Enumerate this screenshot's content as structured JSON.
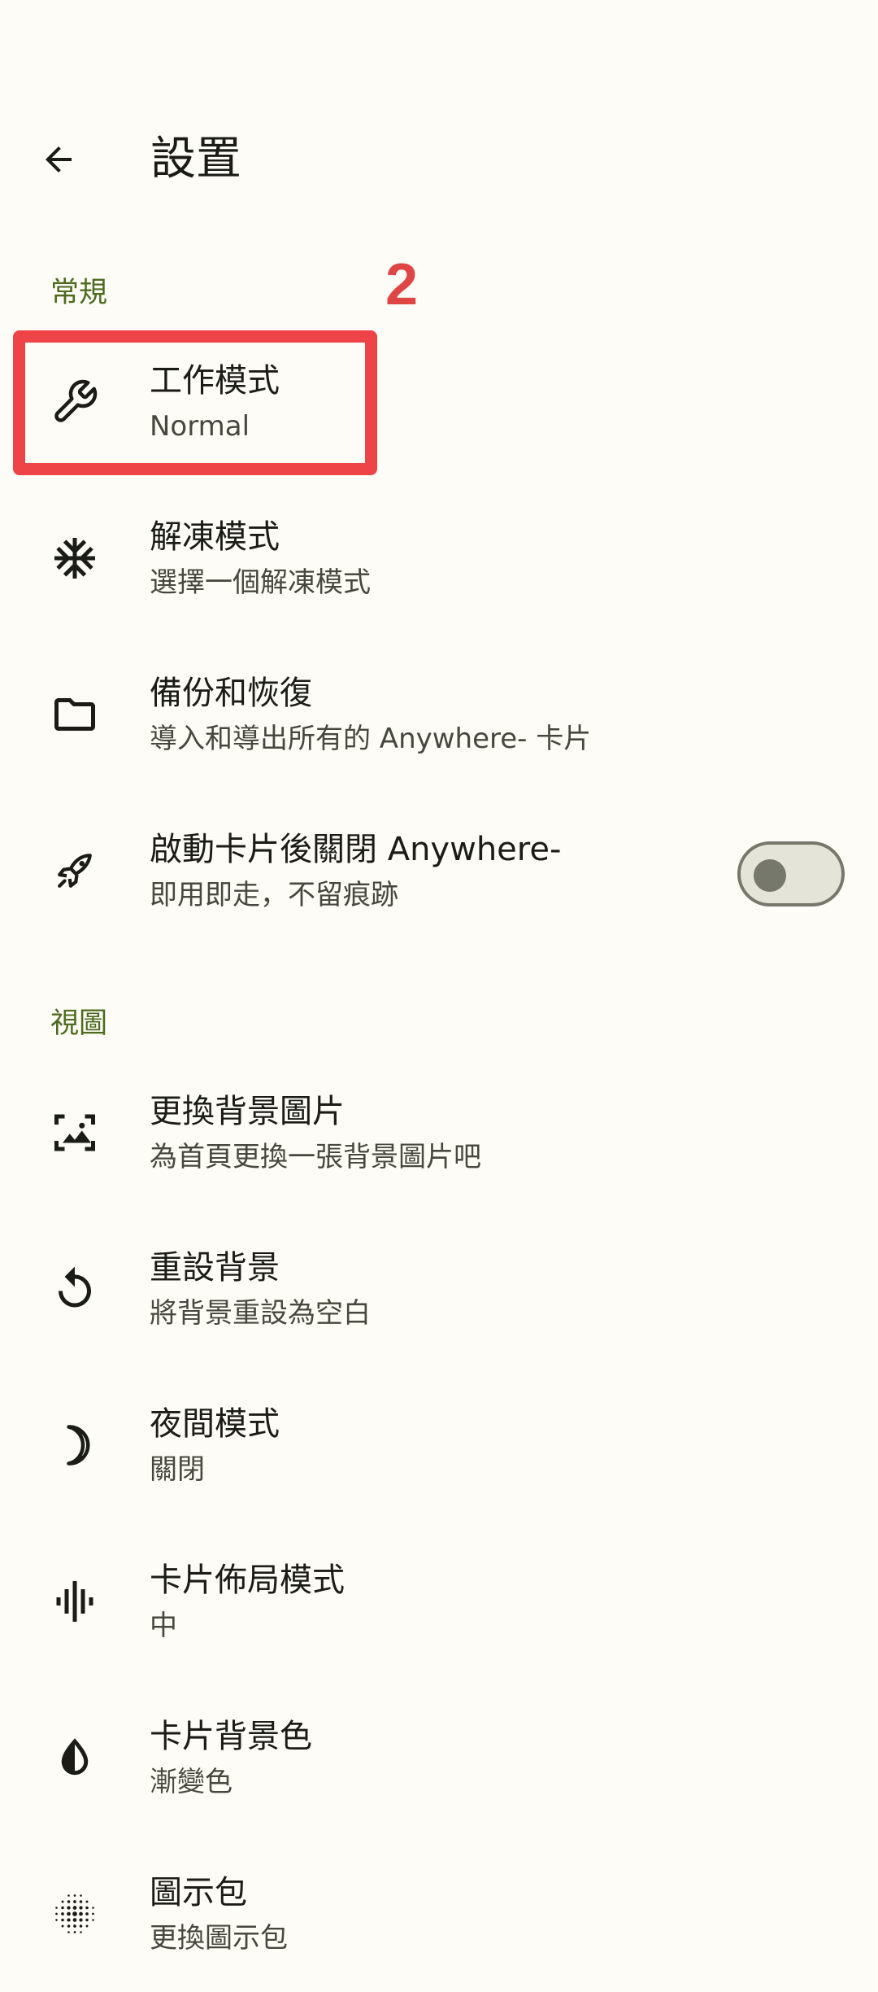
{
  "header": {
    "title": "設置",
    "back_icon": "arrow-back-icon"
  },
  "sections": [
    {
      "label": "常規"
    },
    {
      "label": "視圖"
    }
  ],
  "items": [
    {
      "title": "工作模式",
      "summary": "Normal",
      "icon": "wrench-icon"
    },
    {
      "title": "解凍模式",
      "summary": "選擇一個解凍模式",
      "icon": "snowflake-icon"
    },
    {
      "title": "備份和恢復",
      "summary": "導入和導出所有的 Anywhere- 卡片",
      "icon": "folder-icon"
    },
    {
      "title": "啟動卡片後關閉 Anywhere-",
      "summary": "即用即走，不留痕跡",
      "icon": "rocket-icon",
      "toggle_on": false
    },
    {
      "title": "更換背景圖片",
      "summary": "為首頁更換一張背景圖片吧",
      "icon": "wallpaper-icon"
    },
    {
      "title": "重設背景",
      "summary": "將背景重設為空白",
      "icon": "reset-icon"
    },
    {
      "title": "夜間模式",
      "summary": "關閉",
      "icon": "moon-icon"
    },
    {
      "title": "卡片佈局模式",
      "summary": "中",
      "icon": "graphic-eq-icon"
    },
    {
      "title": "卡片背景色",
      "summary": "漸變色",
      "icon": "contrast-icon"
    },
    {
      "title": "圖示包",
      "summary": "更換圖示包",
      "icon": "dots-grid-icon"
    }
  ],
  "annotation": {
    "number": "2"
  },
  "colors": {
    "background": "#FDFCF6",
    "section_header": "#4C6B1F",
    "annotation": "#EE4347",
    "text_primary": "#1B1C18",
    "text_secondary": "#46483F"
  }
}
